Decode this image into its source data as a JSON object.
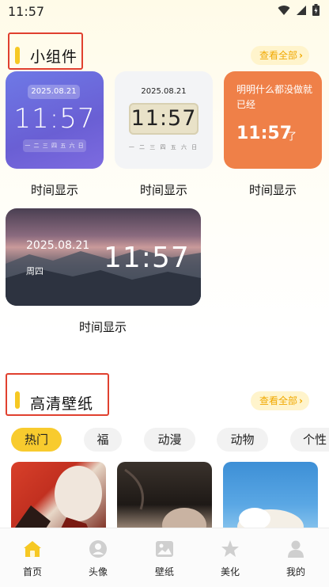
{
  "status_bar": {
    "time": "11:57"
  },
  "widgets_section": {
    "title": "小组件",
    "see_all": "查看全部",
    "cards": [
      {
        "label": "时间显示",
        "date": "2025.08.21",
        "time": "11:57",
        "week": "一 二 三 四 五 六 日"
      },
      {
        "label": "时间显示",
        "date": "2025.08.21",
        "time": "11:57",
        "week": "一 二 三 四 五 六 日"
      },
      {
        "label": "时间显示",
        "text": "明明什么都没做就已经",
        "time": "11:57",
        "suffix": "了"
      },
      {
        "label": "时间显示",
        "date": "2025.08.21",
        "week": "周四",
        "time": "11:57"
      }
    ]
  },
  "wallpaper_section": {
    "title": "高清壁纸",
    "see_all": "查看全部",
    "tabs": [
      "热门",
      "福",
      "动漫",
      "动物",
      "个性"
    ]
  },
  "bottom_nav": {
    "items": [
      {
        "label": "首页",
        "icon": "home-icon"
      },
      {
        "label": "头像",
        "icon": "avatar-icon"
      },
      {
        "label": "壁纸",
        "icon": "image-icon"
      },
      {
        "label": "美化",
        "icon": "star-icon"
      },
      {
        "label": "我的",
        "icon": "person-icon"
      }
    ]
  },
  "colors": {
    "accent": "#f6c823",
    "active_nav": "#f6c823",
    "highlight_box": "#e0402f"
  }
}
